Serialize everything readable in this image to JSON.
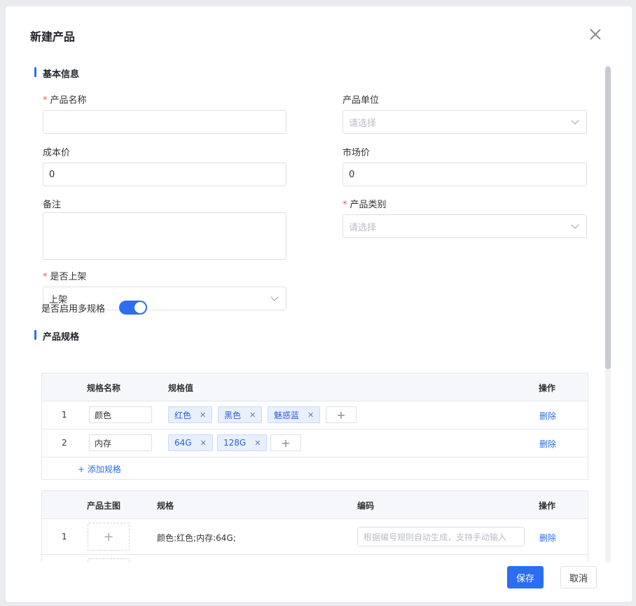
{
  "dialog": {
    "title": "新建产品"
  },
  "basic": {
    "section_title": "基本信息",
    "product_name": {
      "label": "产品名称",
      "value": ""
    },
    "product_unit": {
      "label": "产品单位",
      "placeholder": "请选择"
    },
    "cost_price": {
      "label": "成本价",
      "value": "0"
    },
    "market_price": {
      "label": "市场价",
      "value": "0"
    },
    "remark": {
      "label": "备注",
      "value": ""
    },
    "category": {
      "label": "产品类别",
      "placeholder": "请选择"
    },
    "on_shelf": {
      "label": "是否上架",
      "value": "上架"
    }
  },
  "spec": {
    "section_title": "产品规格",
    "multi_spec_label": "是否启用多规格",
    "multi_spec_enabled": true,
    "table": {
      "headers": {
        "name": "规格名称",
        "values": "规格值",
        "ops": "操作"
      },
      "rows": [
        {
          "index": "1",
          "name": "颜色",
          "tags": [
            "红色",
            "黑色",
            "魅惑蓝"
          ],
          "action": "删除"
        },
        {
          "index": "2",
          "name": "内存",
          "tags": [
            "64G",
            "128G"
          ],
          "action": "删除"
        }
      ],
      "add_label": "+ 添加规格",
      "add_symbol": "+"
    },
    "sku_table": {
      "headers": {
        "image": "产品主图",
        "spec": "规格",
        "code": "编码",
        "ops": "操作"
      },
      "rows": [
        {
          "index": "1",
          "spec": "颜色:红色;内存:64G;",
          "code_placeholder": "根据编号规则自动生成，支持手动输入",
          "action": "删除"
        }
      ]
    }
  },
  "footer": {
    "save": "保存",
    "cancel": "取消"
  }
}
